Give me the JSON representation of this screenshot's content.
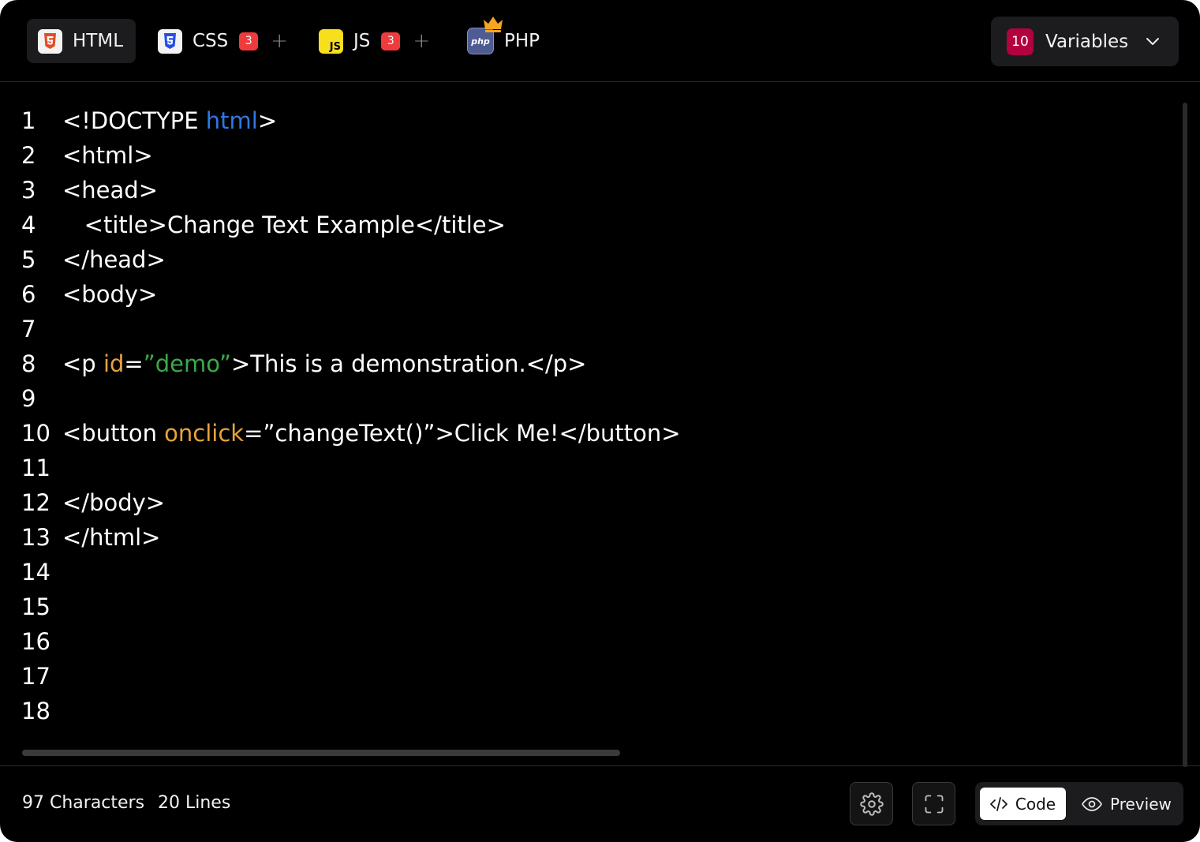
{
  "tabs": [
    {
      "label": "HTML",
      "icon": "html5-icon",
      "active": true
    },
    {
      "label": "CSS",
      "icon": "css3-icon",
      "badge": "3"
    },
    {
      "label": "JS",
      "icon": "javascript-icon",
      "badge": "3"
    },
    {
      "label": "PHP",
      "icon": "php-icon",
      "premium": true
    }
  ],
  "icon_text": {
    "js": "JS",
    "php": "php"
  },
  "add_symbol": "+",
  "variables": {
    "count": "10",
    "label": "Variables"
  },
  "code_lines": [
    {
      "n": "1",
      "parts": [
        {
          "t": "<!DOCTYPE "
        },
        {
          "t": "html",
          "c": "blue"
        },
        {
          "t": ">"
        }
      ]
    },
    {
      "n": "2",
      "parts": [
        {
          "t": "<html>"
        }
      ]
    },
    {
      "n": "3",
      "parts": [
        {
          "t": "<head>"
        }
      ]
    },
    {
      "n": "4",
      "parts": [
        {
          "t": "   <title>Change Text Example</title>"
        }
      ]
    },
    {
      "n": "5",
      "parts": [
        {
          "t": "</head>"
        }
      ]
    },
    {
      "n": "6",
      "parts": [
        {
          "t": "<body>"
        }
      ]
    },
    {
      "n": "7",
      "parts": []
    },
    {
      "n": "8",
      "parts": [
        {
          "t": "<p "
        },
        {
          "t": "id",
          "c": "orange"
        },
        {
          "t": "="
        },
        {
          "t": "”demo”",
          "c": "green"
        },
        {
          "t": ">This is a demonstration.</p>"
        }
      ]
    },
    {
      "n": "9",
      "parts": []
    },
    {
      "n": "10",
      "parts": [
        {
          "t": "<button "
        },
        {
          "t": "onclick",
          "c": "orange"
        },
        {
          "t": "=”changeText()”>Click Me!</button>"
        }
      ]
    },
    {
      "n": "11",
      "parts": []
    },
    {
      "n": "12",
      "parts": [
        {
          "t": "</body>"
        }
      ]
    },
    {
      "n": "13",
      "parts": [
        {
          "t": "</html>"
        }
      ]
    },
    {
      "n": "14",
      "parts": []
    },
    {
      "n": "15",
      "parts": []
    },
    {
      "n": "16",
      "parts": []
    },
    {
      "n": "17",
      "parts": []
    },
    {
      "n": "18",
      "parts": []
    }
  ],
  "syntax_colors": {
    "blue": "#2f78e6",
    "orange": "#e8a33a",
    "green": "#3aa94a"
  },
  "footer": {
    "characters": "97 Characters",
    "lines": "20 Lines",
    "code_label": "Code",
    "preview_label": "Preview"
  }
}
